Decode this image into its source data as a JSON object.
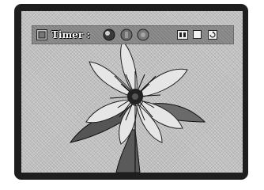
{
  "osd": {
    "timer_label": "Timer :",
    "icons": [
      "photo-icon",
      "speed-slow-icon",
      "speed-medium-icon",
      "speed-fast-icon",
      "zoom-icon",
      "fit-icon",
      "rotate-icon"
    ]
  },
  "colors": {
    "bezel": "#1e1e1e",
    "screen": "#c2c2c2",
    "osd_bar": "#8e8e8e",
    "timer_text": "#ffffff"
  }
}
